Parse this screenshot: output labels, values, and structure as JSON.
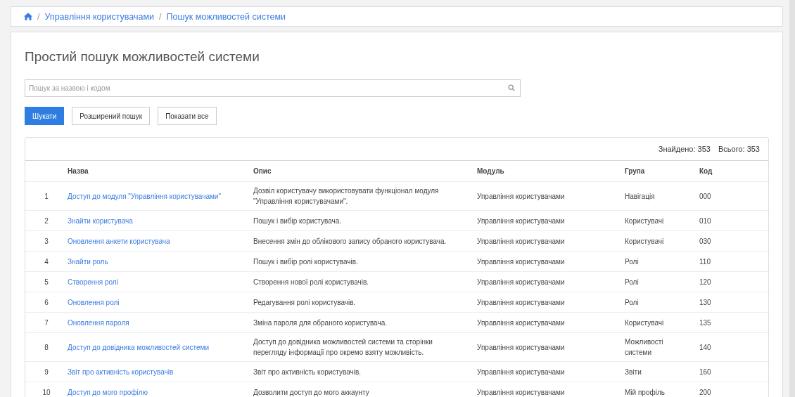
{
  "breadcrumb": [
    {
      "separator": "/",
      "label": "Управління користувачами"
    },
    {
      "separator": "/",
      "label": "Пошук можливостей системи"
    }
  ],
  "page_title": "Простий пошук можливостей системи",
  "search": {
    "placeholder": "Пошук за назвою і кодом"
  },
  "buttons": [
    {
      "label": "Шукати",
      "kind": "primary"
    },
    {
      "label": "Розширений пошук",
      "kind": "default"
    },
    {
      "label": "Показати все",
      "kind": "default"
    }
  ],
  "summary": {
    "found": "Знайдено: 353",
    "total": "Всього: 353"
  },
  "table": {
    "columns": [
      "Назва",
      "Опис",
      "Модуль",
      "Група",
      "Код"
    ],
    "rows": [
      {
        "number": "1",
        "name": "Доступ до модуля \"Управління користувачами\"",
        "description": "Дозвіл користувачу використовувати функціонал модуля \"Управління користувачами\".",
        "module": "Управління користувачами",
        "group": "Навігація",
        "code": "000"
      },
      {
        "number": "2",
        "name": "Знайти користувача",
        "description": "Пошук і вибір користувача.",
        "module": "Управління користувачами",
        "group": "Користувачі",
        "code": "010"
      },
      {
        "number": "3",
        "name": "Оновлення анкети користувача",
        "description": "Внесення змін до облікового запису обраного користувача.",
        "module": "Управління користувачами",
        "group": "Користувачі",
        "code": "030"
      },
      {
        "number": "4",
        "name": "Знайти роль",
        "description": "Пошук і вибір ролі користувачів.",
        "module": "Управління користувачами",
        "group": "Ролі",
        "code": "110"
      },
      {
        "number": "5",
        "name": "Створення ролі",
        "description": "Створення нової ролі користувачів.",
        "module": "Управління користувачами",
        "group": "Ролі",
        "code": "120"
      },
      {
        "number": "6",
        "name": "Оновлення ролі",
        "description": "Редагування ролі користувачів.",
        "module": "Управління користувачами",
        "group": "Ролі",
        "code": "130"
      },
      {
        "number": "7",
        "name": "Оновлення пароля",
        "description": "Зміна пароля для обраного користувача.",
        "module": "Управління користувачами",
        "group": "Користувачі",
        "code": "135"
      },
      {
        "number": "8",
        "name": "Доступ до довідника можливостей системи",
        "description": "Доступ до довідника можливостей системи та сторінки перегляду інформації про окремо взяту можливість.",
        "module": "Управління користувачами",
        "group": "Можливості системи",
        "code": "140"
      },
      {
        "number": "9",
        "name": "Звіт про активність користувачів",
        "description": "Звіт про активність користувачів.",
        "module": "Управління користувачами",
        "group": "Звіти",
        "code": "160"
      },
      {
        "number": "10",
        "name": "Доступ до мого профілю",
        "description": "Дозволити доступ до мого аккаунту",
        "module": "Управління користувачами",
        "group": "Мій профіль",
        "code": "200"
      }
    ]
  }
}
